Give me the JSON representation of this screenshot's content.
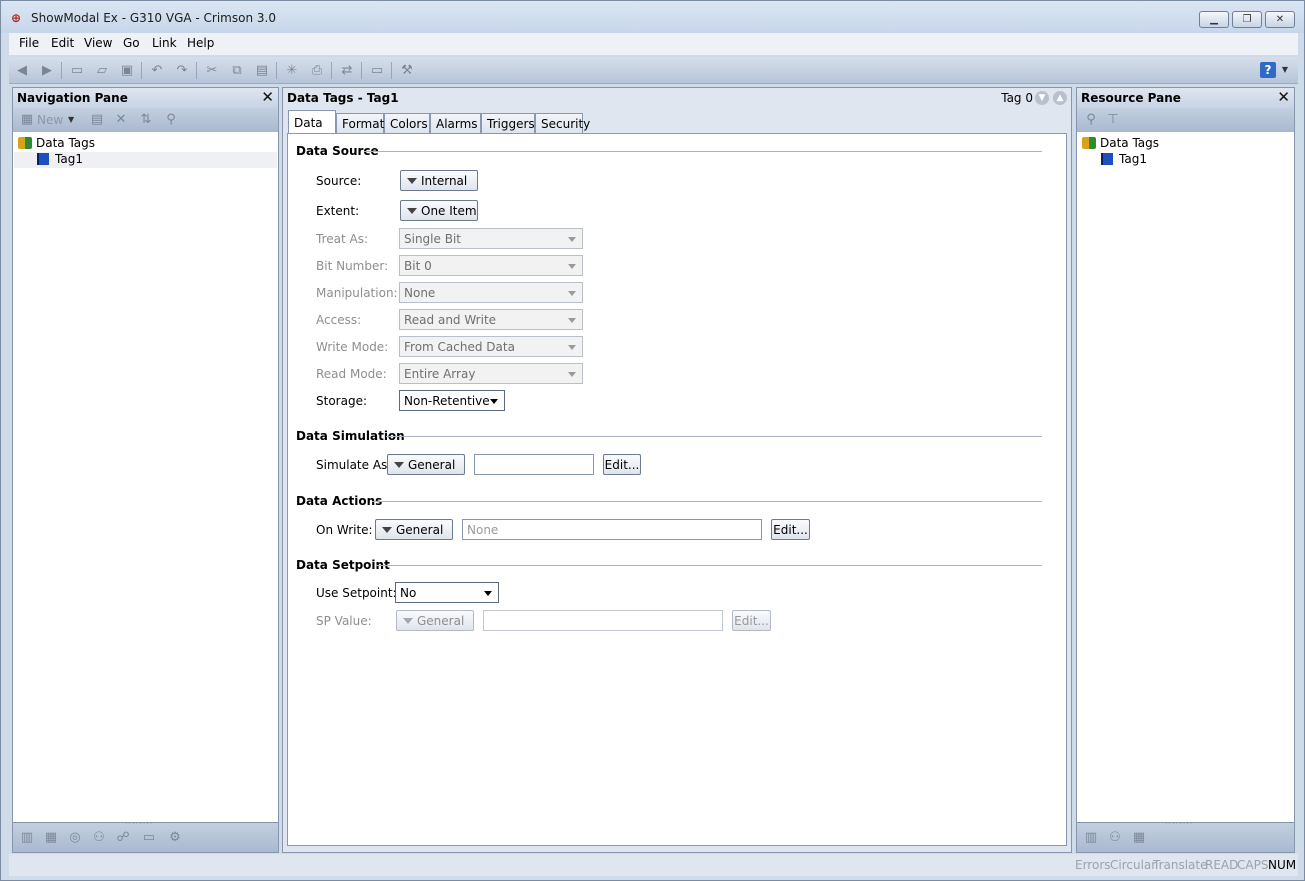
{
  "window": {
    "title": "ShowModal Ex - G310 VGA - Crimson 3.0",
    "app_icon": "crimson-logo-icon",
    "controls": [
      "minimize-icon",
      "restore-icon",
      "close-icon"
    ]
  },
  "menu": [
    "File",
    "Edit",
    "View",
    "Go",
    "Link",
    "Help"
  ],
  "toolbar": {
    "icons": [
      "back-icon",
      "forward-icon",
      "new-icon",
      "open-icon",
      "save-icon",
      "undo-icon",
      "redo-icon",
      "cut-icon",
      "copy-icon",
      "paste-icon",
      "find-icon",
      "print-icon",
      "link-icon",
      "frame-icon",
      "wand-icon",
      "help-icon"
    ]
  },
  "navigation_pane": {
    "title": "Navigation Pane",
    "new_label": "New",
    "tree": {
      "root": "Data Tags",
      "children": [
        "Tag1"
      ]
    }
  },
  "editor": {
    "title": "Data Tags - Tag1",
    "tag_indicator": "Tag 0",
    "tabs": [
      "Data",
      "Format",
      "Colors",
      "Alarms",
      "Triggers",
      "Security"
    ],
    "active_tab": "Data",
    "data_source": {
      "heading": "Data Source",
      "source_label": "Source:",
      "source_value": "Internal",
      "extent_label": "Extent:",
      "extent_value": "One Item",
      "treat_as_label": "Treat As:",
      "treat_as_value": "Single Bit",
      "bit_number_label": "Bit Number:",
      "bit_number_value": "Bit 0",
      "manipulation_label": "Manipulation:",
      "manipulation_value": "None",
      "access_label": "Access:",
      "access_value": "Read and Write",
      "write_mode_label": "Write Mode:",
      "write_mode_value": "From Cached Data",
      "read_mode_label": "Read Mode:",
      "read_mode_value": "Entire Array",
      "storage_label": "Storage:",
      "storage_value": "Non-Retentive"
    },
    "data_simulation": {
      "heading": "Data Simulation",
      "simulate_label": "Simulate As:",
      "simulate_mode": "General",
      "simulate_value": "",
      "edit_label": "Edit..."
    },
    "data_actions": {
      "heading": "Data Actions",
      "on_write_label": "On Write:",
      "on_write_mode": "General",
      "on_write_placeholder": "None",
      "edit_label": "Edit..."
    },
    "data_setpoint": {
      "heading": "Data Setpoint",
      "use_setpoint_label": "Use Setpoint:",
      "use_setpoint_value": "No",
      "sp_value_label": "SP Value:",
      "sp_mode": "General",
      "sp_value": "",
      "edit_label": "Edit..."
    }
  },
  "resource_pane": {
    "title": "Resource Pane",
    "tree": {
      "root": "Data Tags",
      "children": [
        "Tag1"
      ]
    }
  },
  "statusbar": {
    "items": [
      "Errors",
      "Circular",
      "Translate",
      "READ",
      "CAPS",
      "NUM"
    ],
    "active": "NUM"
  }
}
